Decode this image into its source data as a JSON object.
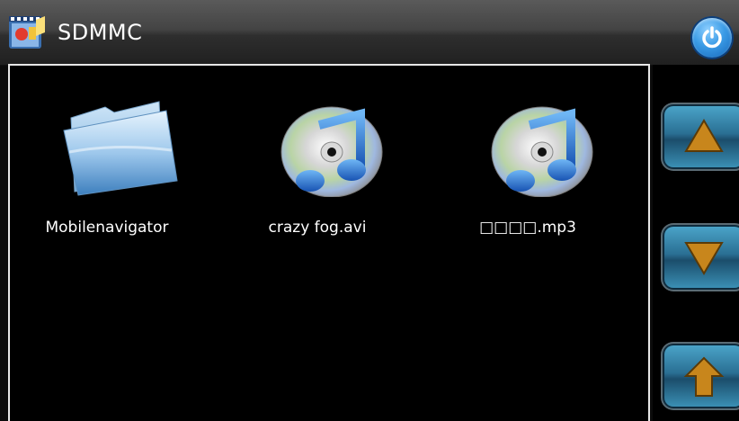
{
  "titlebar": {
    "title": "SDMMC",
    "app_icon": "media-player-icon",
    "power_icon": "power-icon",
    "power_color": "#2f8be0"
  },
  "files": [
    {
      "name": "Mobilenavigator",
      "icon": "folder-icon"
    },
    {
      "name": "crazy fog.avi",
      "icon": "music-disc-icon"
    },
    {
      "name": "□□□□.mp3",
      "icon": "music-disc-icon"
    }
  ],
  "nav": {
    "up_icon": "triangle-up-icon",
    "down_icon": "triangle-down-icon",
    "parent_icon": "arrow-up-icon",
    "button_color": "#2a6f93",
    "arrow_color": "#c8861c"
  }
}
